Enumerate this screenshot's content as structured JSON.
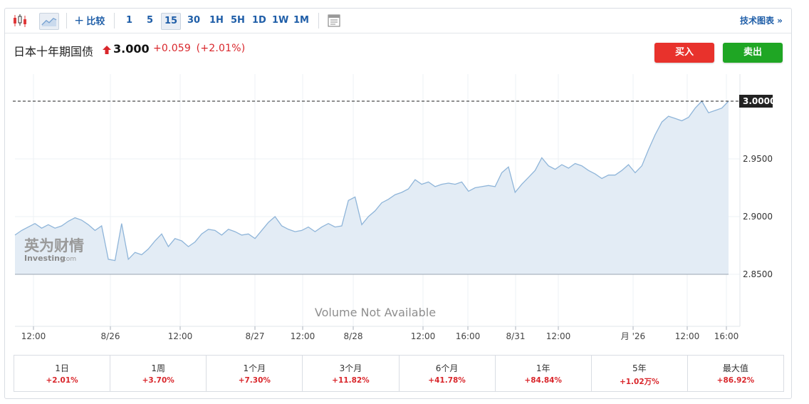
{
  "toolbar": {
    "compare_label": "比较",
    "intervals": [
      "1",
      "5",
      "15",
      "30",
      "1H",
      "5H",
      "1D",
      "1W",
      "1M"
    ],
    "active_interval": "15",
    "tech_chart_link": "技术图表 »"
  },
  "instrument": {
    "name": "日本十年期国债",
    "price": "3.000",
    "change": "+0.059",
    "change_pct": "(+2.01%)"
  },
  "actions": {
    "buy_label": "买入",
    "sell_label": "卖出"
  },
  "watermark": {
    "cn": "英为财情",
    "en": "Investing",
    "suffix": ".com"
  },
  "volume_note": "Volume Not Available",
  "colors": {
    "up": "#d9262b",
    "buy": "#e8322c",
    "sell": "#1fa624",
    "line": "#8fb5d9",
    "area": "#e3ecf5",
    "link": "#1f5ea8"
  },
  "chart_data": {
    "type": "area",
    "y_axis": {
      "ticks": [
        "3.0000",
        "2.9500",
        "2.9000",
        "2.8500"
      ],
      "ylim": [
        2.83,
        3.008
      ],
      "current_value_label": "3.0000",
      "position": "right"
    },
    "x_axis": {
      "ticks": [
        "12:00",
        "8/26",
        "12:00",
        "8/27",
        "12:00",
        "8/28",
        "12:00",
        "16:00",
        "8/31",
        "12:00",
        "月 '26",
        "12:00",
        "16:00"
      ]
    },
    "grid": true,
    "series": [
      {
        "values": [
          2.884,
          2.888,
          2.891,
          2.894,
          2.89,
          2.893,
          2.89,
          2.892,
          2.896,
          2.899,
          2.897,
          2.893,
          2.888,
          2.892,
          2.863,
          2.862,
          2.894,
          2.863,
          2.869,
          2.867,
          2.872,
          2.879,
          2.885,
          2.874,
          2.881,
          2.879,
          2.874,
          2.878,
          2.885,
          2.889,
          2.888,
          2.884,
          2.889,
          2.887,
          2.884,
          2.885,
          2.881,
          2.888,
          2.895,
          2.9,
          2.892,
          2.889,
          2.887,
          2.888,
          2.891,
          2.887,
          2.891,
          2.894,
          2.891,
          2.892,
          2.914,
          2.917,
          2.893,
          2.9,
          2.905,
          2.912,
          2.915,
          2.919,
          2.921,
          2.924,
          2.932,
          2.928,
          2.93,
          2.926,
          2.928,
          2.929,
          2.928,
          2.93,
          2.922,
          2.925,
          2.926,
          2.927,
          2.926,
          2.938,
          2.943,
          2.921,
          2.928,
          2.934,
          2.94,
          2.951,
          2.944,
          2.941,
          2.945,
          2.942,
          2.946,
          2.944,
          2.94,
          2.937,
          2.933,
          2.936,
          2.936,
          2.94,
          2.945,
          2.938,
          2.944,
          2.958,
          2.971,
          2.982,
          2.987,
          2.985,
          2.983,
          2.986,
          2.994,
          3.0,
          2.99,
          2.992,
          2.994,
          3.0
        ]
      }
    ]
  },
  "performance": [
    {
      "label": "1日",
      "value": "+2.01%"
    },
    {
      "label": "1周",
      "value": "+3.70%"
    },
    {
      "label": "1个月",
      "value": "+7.30%"
    },
    {
      "label": "3个月",
      "value": "+11.82%"
    },
    {
      "label": "6个月",
      "value": "+41.78%"
    },
    {
      "label": "1年",
      "value": "+84.84%"
    },
    {
      "label": "5年",
      "value": "+1.02万%"
    },
    {
      "label": "最大值",
      "value": "+86.92%"
    }
  ]
}
